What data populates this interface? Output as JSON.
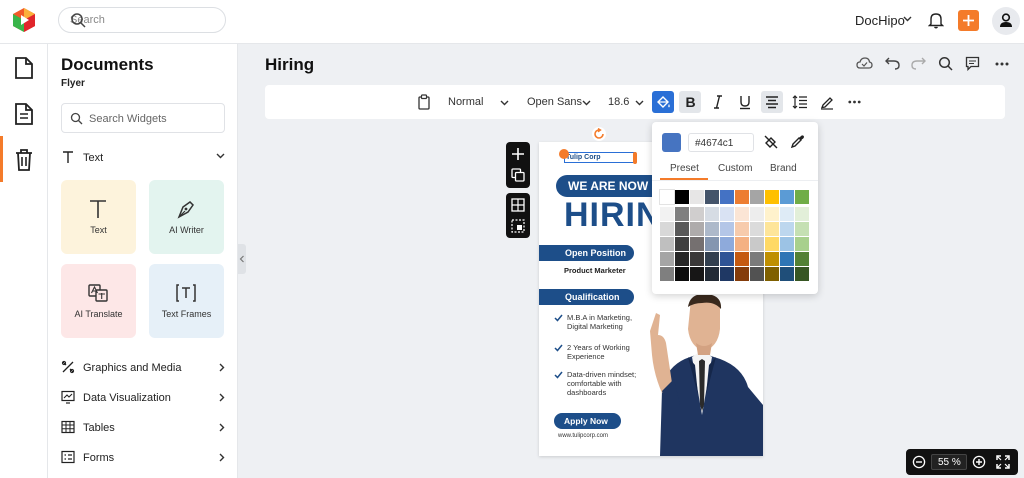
{
  "topbar": {
    "search_placeholder": "Search",
    "brand": "DocHipo",
    "colors": {
      "accent": "#f47b2a"
    }
  },
  "leftrail": {
    "icons": [
      "document-icon",
      "page-icon",
      "trash-icon"
    ],
    "active": "page-icon"
  },
  "panel": {
    "title": "Documents",
    "subtitle": "Flyer",
    "search_placeholder": "Search Widgets",
    "text_section": "Text",
    "tiles": [
      {
        "label": "Text",
        "icon": "text-t-icon",
        "color": "#fdf3dc"
      },
      {
        "label": "AI Writer",
        "icon": "pen-nib-icon",
        "color": "#e3f4ef"
      },
      {
        "label": "AI Translate",
        "icon": "translate-icon",
        "color": "#fde7e7"
      },
      {
        "label": "Text Frames",
        "icon": "text-frame-icon",
        "color": "#e6f0f8"
      }
    ],
    "sections": [
      {
        "label": "Graphics and Media",
        "icon": "graphics-icon"
      },
      {
        "label": "Data Visualization",
        "icon": "chart-icon"
      },
      {
        "label": "Tables",
        "icon": "table-icon"
      },
      {
        "label": "Forms",
        "icon": "form-icon"
      }
    ]
  },
  "editor": {
    "doc_title": "Hiring",
    "toolbar": {
      "style": "Normal",
      "font": "Open Sans",
      "size": "18.6"
    },
    "zoom": "55 %"
  },
  "flyer": {
    "company": "Tulip Corp",
    "banner": "WE ARE NOW",
    "headline": "HIRING",
    "open_position_label": "Open Position",
    "open_position_value": "Product Marketer",
    "qualification_label": "Qualification",
    "qualifications": [
      "M.B.A in Marketing, Digital Marketing",
      "2 Years of Working Experience",
      "Data-driven mindset; comfortable with dashboards"
    ],
    "apply": "Apply Now",
    "url": "www.tulipcorp.com",
    "colors": {
      "primary": "#1d4e89"
    }
  },
  "color_picker": {
    "hex": "#4674c1",
    "tabs": [
      "Preset",
      "Custom",
      "Brand"
    ],
    "active_tab": "Preset",
    "palette": [
      [
        "#ffffff",
        "#000000",
        "#e7e6e6",
        "#44546a",
        "#4472c4",
        "#ed7d31",
        "#a5a5a5",
        "#ffc000",
        "#5b9bd5",
        "#70ad47"
      ],
      [
        "#f2f2f2",
        "#7f7f7f",
        "#d0cece",
        "#d6dce4",
        "#d9e2f3",
        "#fbe5d5",
        "#ededed",
        "#fff2cc",
        "#deebf6",
        "#e2efd9"
      ],
      [
        "#d8d8d8",
        "#595959",
        "#aeabab",
        "#adb9ca",
        "#b4c6e7",
        "#f7cbac",
        "#dbdbdb",
        "#fee599",
        "#bdd7ee",
        "#c5e0b3"
      ],
      [
        "#bfbfbf",
        "#3f3f3f",
        "#757070",
        "#8496b0",
        "#8eaadb",
        "#f4b183",
        "#c9c9c9",
        "#ffd965",
        "#9cc3e5",
        "#a8d08d"
      ],
      [
        "#a5a5a5",
        "#262626",
        "#3a3838",
        "#323f4f",
        "#2f5496",
        "#c55a11",
        "#7b7b7b",
        "#bf8f00",
        "#2e75b5",
        "#538135"
      ],
      [
        "#7f7f7f",
        "#0c0c0c",
        "#171616",
        "#222a35",
        "#1f3864",
        "#843c0b",
        "#525252",
        "#7f6000",
        "#1f4e79",
        "#375623"
      ]
    ]
  }
}
